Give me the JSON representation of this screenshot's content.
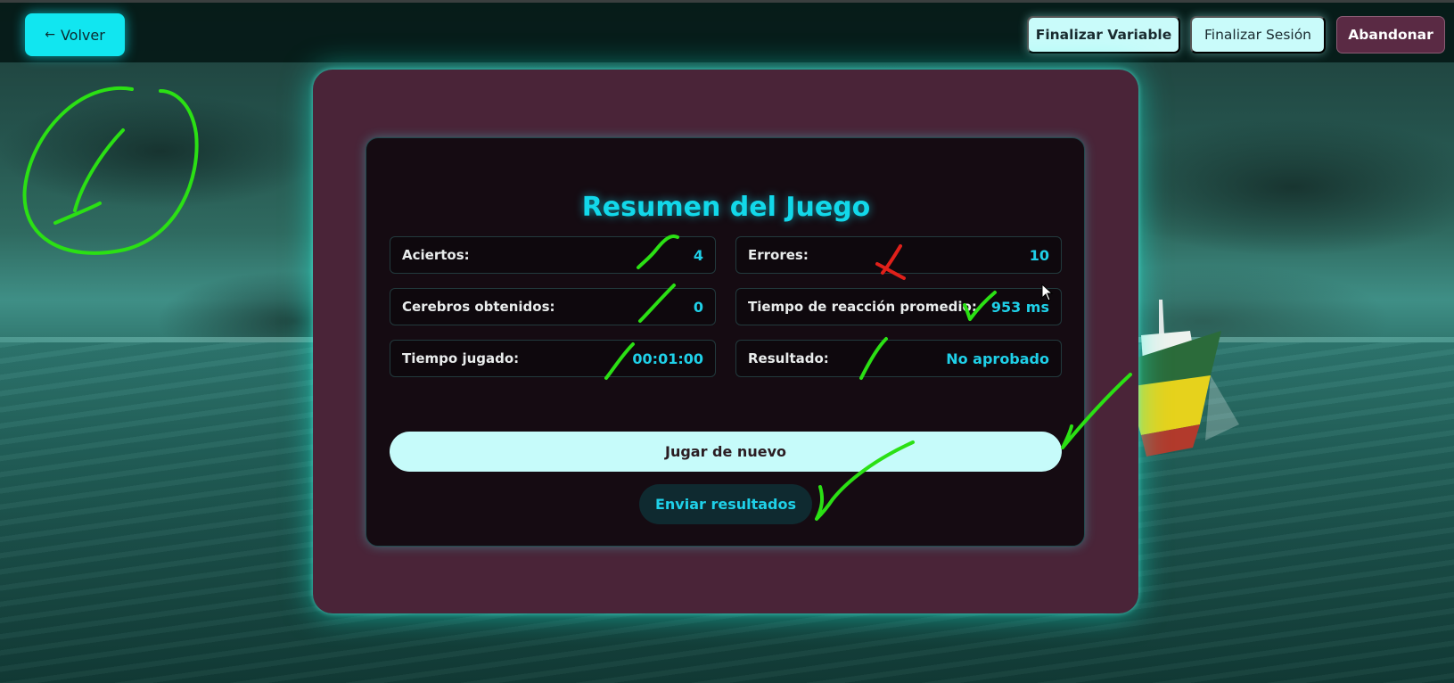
{
  "topbar": {
    "back_label": "Volver",
    "back_icon": "left-arrow-icon",
    "finalize_variable_label": "Finalizar Variable",
    "finalize_session_label": "Finalizar Sesión",
    "abandon_label": "Abandonar"
  },
  "summary": {
    "title": "Resumen del Juego",
    "stats": [
      {
        "label": "Aciertos:",
        "value": "4"
      },
      {
        "label": "Errores:",
        "value": "10"
      },
      {
        "label": "Cerebros obtenidos:",
        "value": "0"
      },
      {
        "label": "Tiempo de reacción promedio:",
        "value": "953 ms"
      },
      {
        "label": "Tiempo jugado:",
        "value": "00:01:00"
      },
      {
        "label": "Resultado:",
        "value": "No aprobado"
      }
    ],
    "play_again_label": "Jugar de nuevo",
    "send_results_label": "Enviar resultados"
  },
  "colors": {
    "accent_cyan": "#12d8ea",
    "frame": "#4a2438",
    "card": "#150b12",
    "annotation_green": "#2be014",
    "annotation_red": "#e0201a"
  }
}
